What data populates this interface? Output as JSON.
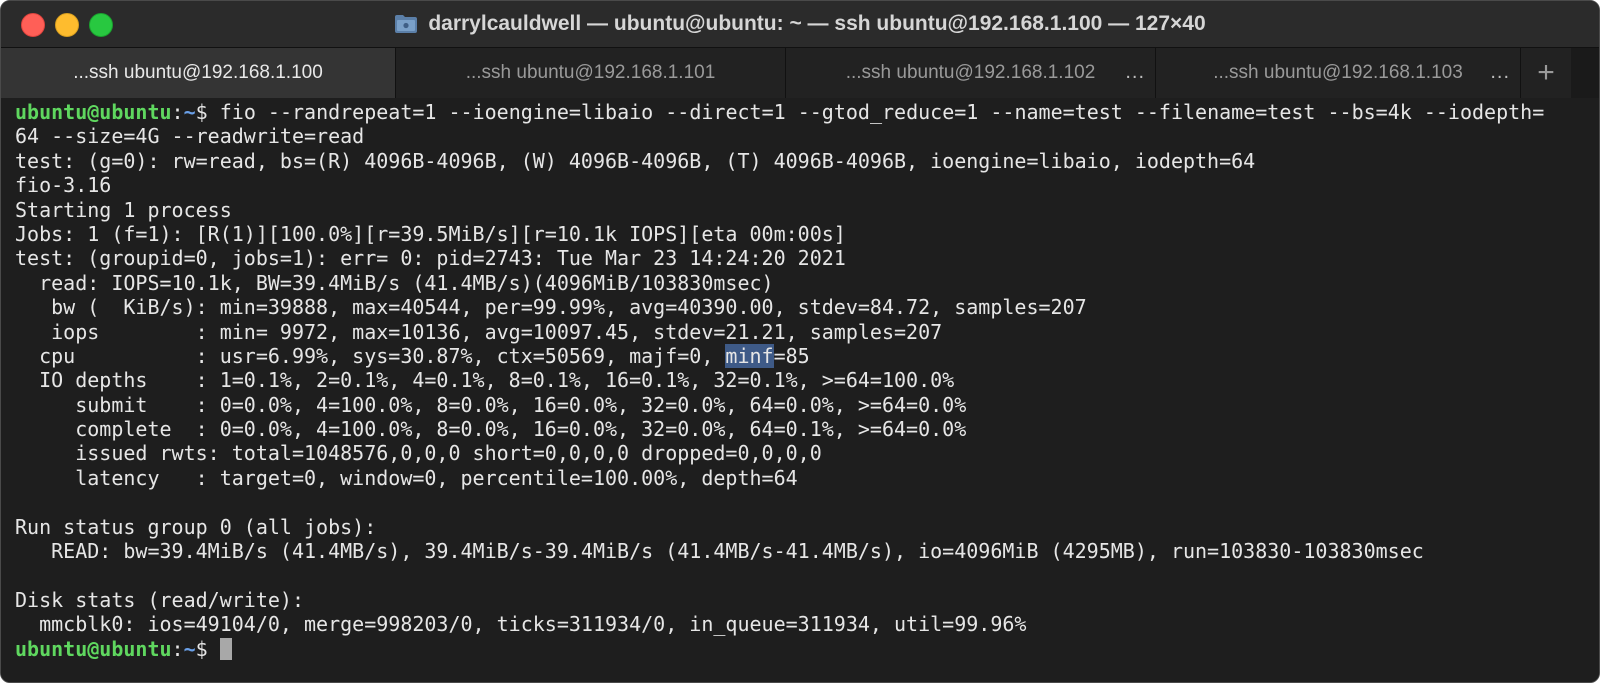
{
  "window": {
    "title": "darrylcauldwell — ubuntu@ubuntu: ~ — ssh ubuntu@192.168.1.100 — 127×40",
    "colors": {
      "background": "#1e1e1e",
      "prompt_user": "#5fd75f",
      "prompt_path": "#6aa0e8",
      "selection": "#3e5a87"
    }
  },
  "tabs": [
    {
      "label": "...ssh ubuntu@192.168.1.100",
      "active": true
    },
    {
      "label": "...ssh ubuntu@192.168.1.101",
      "active": false
    },
    {
      "label": "...ssh ubuntu@192.168.1.102",
      "active": false
    },
    {
      "label": "...ssh ubuntu@192.168.1.103",
      "active": false
    }
  ],
  "tab_more": "...",
  "tab_add": "+",
  "prompt": {
    "user": "ubuntu@ubuntu",
    "colon": ":",
    "path": "~",
    "symbol": "$ "
  },
  "command": {
    "line1": "fio --randrepeat=1 --ioengine=libaio --direct=1 --gtod_reduce=1 --name=test --filename=test --bs=4k --iodepth=",
    "line2": "64 --size=4G --readwrite=read"
  },
  "output": {
    "l03": "test: (g=0): rw=read, bs=(R) 4096B-4096B, (W) 4096B-4096B, (T) 4096B-4096B, ioengine=libaio, iodepth=64",
    "l04": "fio-3.16",
    "l05": "Starting 1 process",
    "l06": "Jobs: 1 (f=1): [R(1)][100.0%][r=39.5MiB/s][r=10.1k IOPS][eta 00m:00s]",
    "l07": "test: (groupid=0, jobs=1): err= 0: pid=2743: Tue Mar 23 14:24:20 2021",
    "l08": "  read: IOPS=10.1k, BW=39.4MiB/s (41.4MB/s)(4096MiB/103830msec)",
    "l09": "   bw (  KiB/s): min=39888, max=40544, per=99.99%, avg=40390.00, stdev=84.72, samples=207",
    "l10": "   iops        : min= 9972, max=10136, avg=10097.45, stdev=21.21, samples=207",
    "l11_pre": "  cpu          : usr=6.99%, sys=30.87%, ctx=50569, majf=0, ",
    "l11_sel": "minf",
    "l11_post": "=85",
    "l12": "  IO depths    : 1=0.1%, 2=0.1%, 4=0.1%, 8=0.1%, 16=0.1%, 32=0.1%, >=64=100.0%",
    "l13": "     submit    : 0=0.0%, 4=100.0%, 8=0.0%, 16=0.0%, 32=0.0%, 64=0.0%, >=64=0.0%",
    "l14": "     complete  : 0=0.0%, 4=100.0%, 8=0.0%, 16=0.0%, 32=0.0%, 64=0.1%, >=64=0.0%",
    "l15": "     issued rwts: total=1048576,0,0,0 short=0,0,0,0 dropped=0,0,0,0",
    "l16": "     latency   : target=0, window=0, percentile=100.00%, depth=64",
    "l18": "Run status group 0 (all jobs):",
    "l19": "   READ: bw=39.4MiB/s (41.4MB/s), 39.4MiB/s-39.4MiB/s (41.4MB/s-41.4MB/s), io=4096MiB (4295MB), run=103830-103830msec",
    "l21": "Disk stats (read/write):",
    "l22": "  mmcblk0: ios=49104/0, merge=998203/0, ticks=311934/0, in_queue=311934, util=99.96%"
  }
}
